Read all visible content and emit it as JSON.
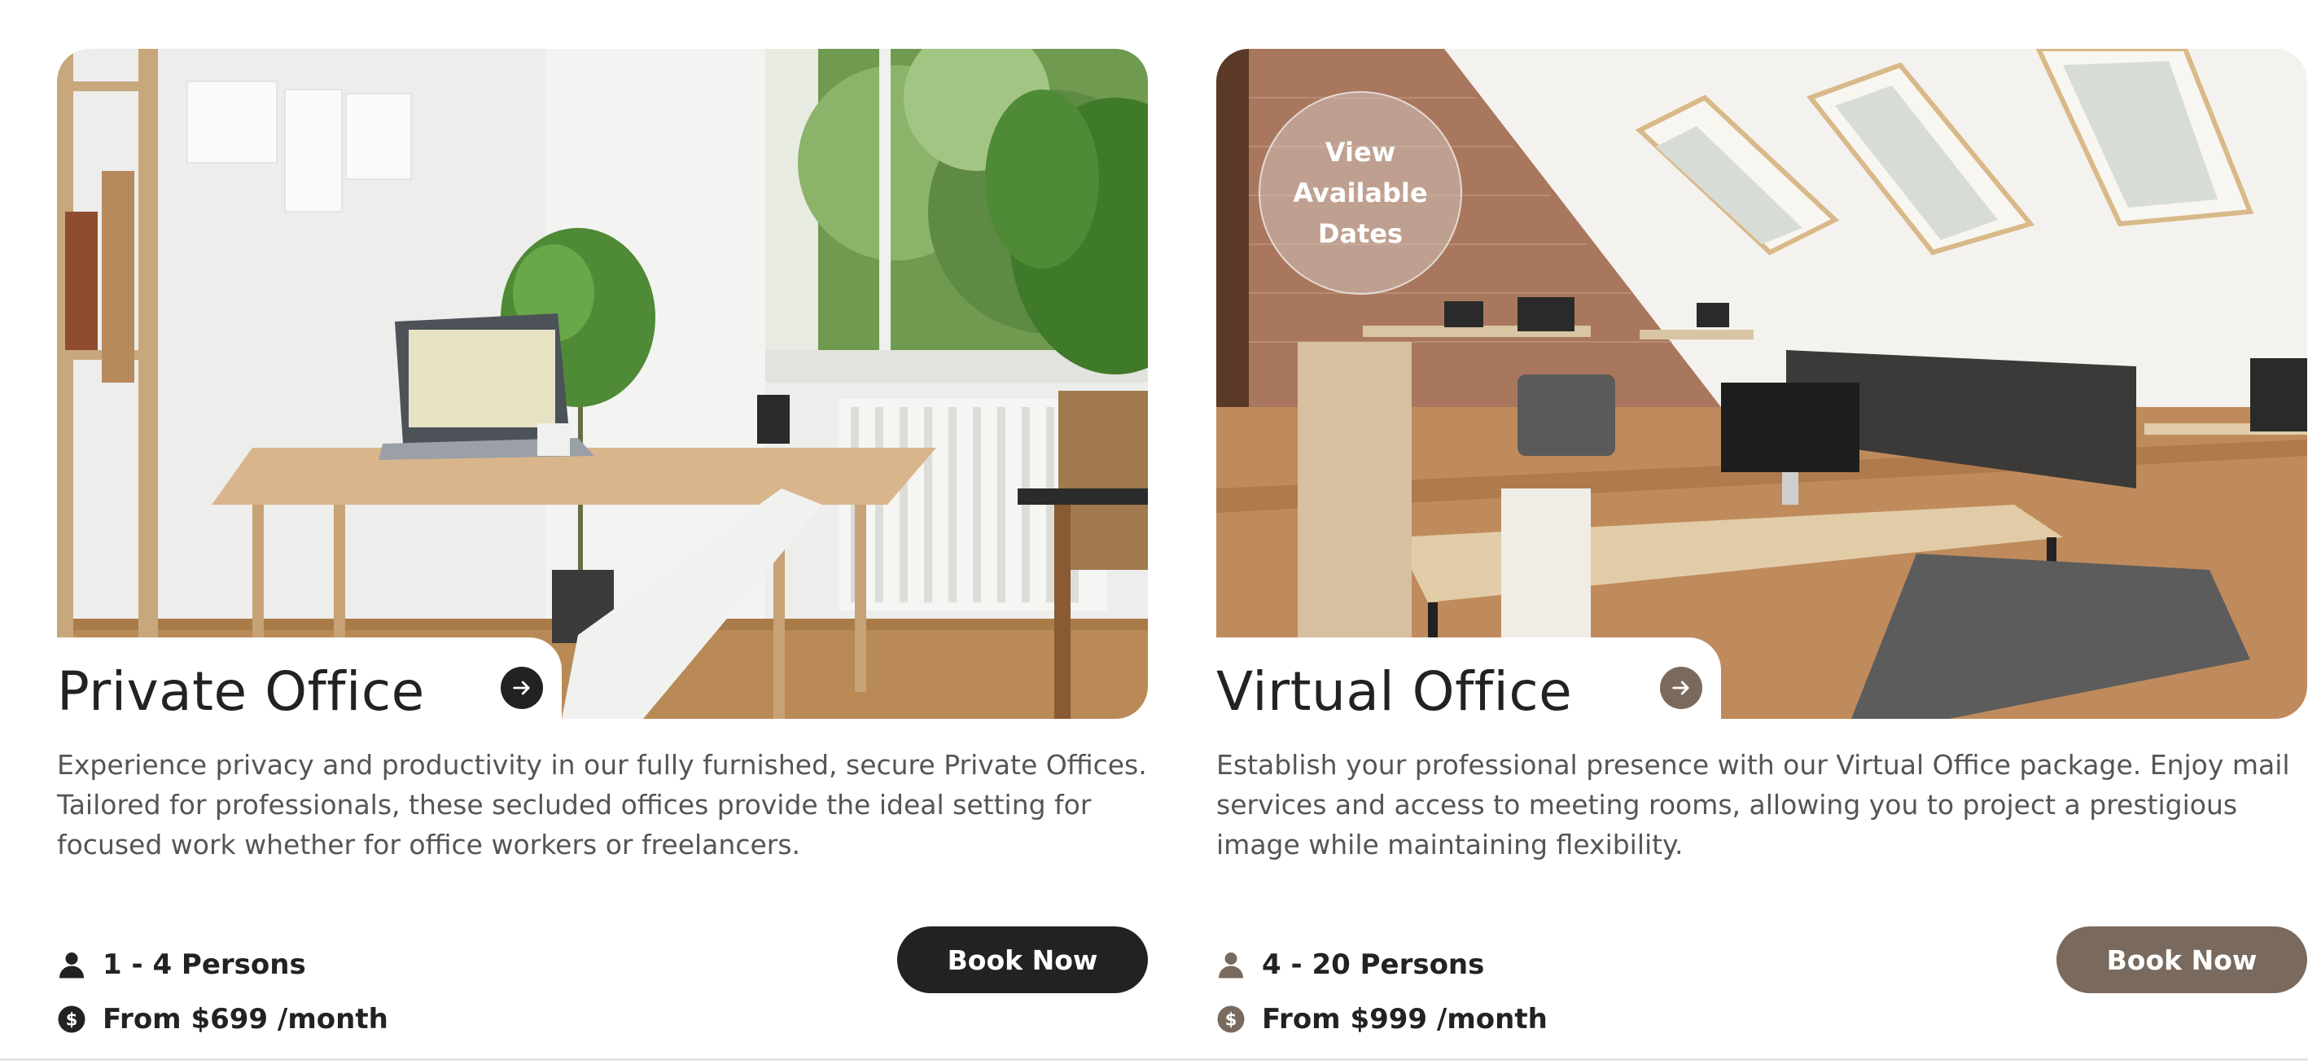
{
  "theme": {
    "dark": "#222222",
    "accent": "#7a6a5d",
    "text_muted": "#555555"
  },
  "cards": [
    {
      "title": "Private Office",
      "description": "Experience privacy and productivity in our fully furnished, secure Private Offices. Tailored for professionals, these secluded offices provide the ideal setting for focused work whether for office workers or freelancers.",
      "persons": "1 - 4 Persons",
      "price": "From $699 /month",
      "cta": "Book Now",
      "arrow_icon": "arrow-right-icon",
      "accent": "#222222"
    },
    {
      "title": "Virtual Office",
      "badge": "View Available Dates",
      "description": "Establish your professional presence with our Virtual Office package. Enjoy mail services and access to meeting rooms, allowing you to project a prestigious image while maintaining flexibility.",
      "persons": "4 - 20 Persons",
      "price": "From $999 /month",
      "cta": "Book Now",
      "arrow_icon": "arrow-right-icon",
      "accent": "#7a6a5d"
    }
  ]
}
